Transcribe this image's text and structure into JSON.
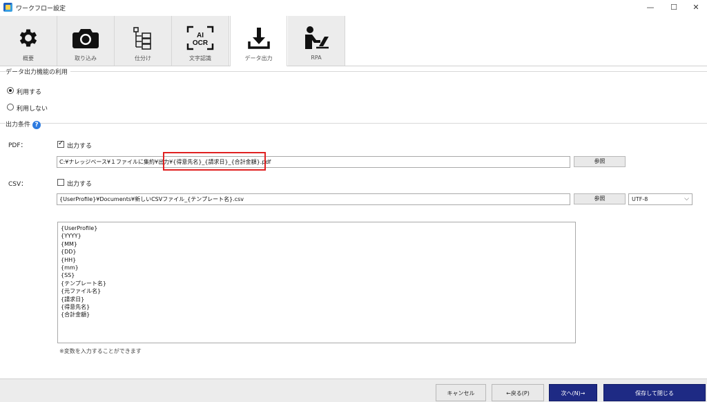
{
  "window": {
    "title": "ワークフロー設定",
    "minimize": "—",
    "maximize": "☐",
    "close": "✕"
  },
  "tabs": [
    {
      "label": "概要",
      "icon": "gear-icon"
    },
    {
      "label": "取り込み",
      "icon": "camera-icon"
    },
    {
      "label": "仕分け",
      "icon": "tree-icon"
    },
    {
      "label": "文字認識",
      "icon": "ai-ocr-icon"
    },
    {
      "label": "データ出力",
      "icon": "download-icon",
      "active": true
    },
    {
      "label": "RPA",
      "icon": "person-laptop-icon"
    }
  ],
  "ocr_icon_text": {
    "line1": "AI",
    "line2": "OCR"
  },
  "usage": {
    "section_title": "データ出力機能の利用",
    "options": [
      {
        "label": "利用する",
        "selected": true
      },
      {
        "label": "利用しない",
        "selected": false
      }
    ]
  },
  "output": {
    "section_title": "出力条件",
    "help": "?",
    "pdf": {
      "label": "PDF：",
      "checkbox_label": "出力する",
      "checked": true,
      "path": "C:¥ナレッジベース¥１ファイルに集約¥出力¥{得意先名}_{請求日}_{合計金額}.pdf",
      "browse": "参照"
    },
    "csv": {
      "label": "CSV：",
      "checkbox_label": "出力する",
      "checked": false,
      "path": "{UserProfile}¥Documents¥新しいCSVファイル_{テンプレート名}.csv",
      "browse": "参照",
      "encoding": "UTF-8"
    }
  },
  "variables": [
    "{UserProfile}",
    "{YYYY}",
    "{MM}",
    "{DD}",
    "{HH}",
    "{mm}",
    "{SS}",
    "{テンプレート名}",
    "{元ファイル名}",
    "{請求日}",
    "{得意先名}",
    "{合計金額}"
  ],
  "note": "※変数を入力することができます",
  "footer": {
    "cancel": "キャンセル",
    "back": "←戻る(P)",
    "next": "次へ(N)→",
    "save_close": "保存して閉じる"
  },
  "colors": {
    "accent_dark": "#1e2a84",
    "highlight": "#e02020",
    "help": "#2d7be0"
  }
}
